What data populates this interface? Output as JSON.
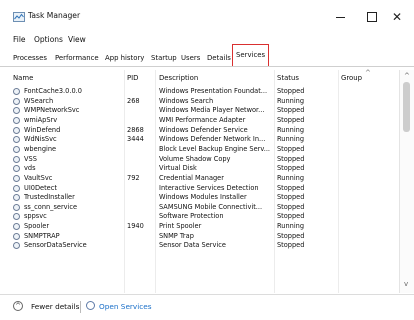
{
  "window": {
    "title": "Task Manager",
    "minimize_icon": "minimize-icon",
    "maximize_icon": "maximize-icon",
    "close_icon": "close-icon",
    "close_glyph": "✕"
  },
  "menu": [
    "File",
    "Options",
    "View"
  ],
  "tabs": [
    {
      "label": "Processes",
      "active": false
    },
    {
      "label": "Performance",
      "active": false
    },
    {
      "label": "App history",
      "active": false
    },
    {
      "label": "Startup",
      "active": false
    },
    {
      "label": "Users",
      "active": false
    },
    {
      "label": "Details",
      "active": false
    },
    {
      "label": "Services",
      "active": true
    }
  ],
  "columns": [
    "Name",
    "PID",
    "Description",
    "Status",
    "Group"
  ],
  "rows": [
    {
      "name": "FontCache3.0.0.0",
      "pid": "",
      "description": "Windows Presentation Foundat...",
      "status": "Stopped",
      "group": ""
    },
    {
      "name": "WSearch",
      "pid": "268",
      "description": "Windows Search",
      "status": "Running",
      "group": ""
    },
    {
      "name": "WMPNetworkSvc",
      "pid": "",
      "description": "Windows Media Player Networ...",
      "status": "Stopped",
      "group": ""
    },
    {
      "name": "wmiApSrv",
      "pid": "",
      "description": "WMI Performance Adapter",
      "status": "Stopped",
      "group": ""
    },
    {
      "name": "WinDefend",
      "pid": "2868",
      "description": "Windows Defender Service",
      "status": "Running",
      "group": ""
    },
    {
      "name": "WdNisSvc",
      "pid": "3444",
      "description": "Windows Defender Network In...",
      "status": "Running",
      "group": ""
    },
    {
      "name": "wbengine",
      "pid": "",
      "description": "Block Level Backup Engine Serv...",
      "status": "Stopped",
      "group": ""
    },
    {
      "name": "VSS",
      "pid": "",
      "description": "Volume Shadow Copy",
      "status": "Stopped",
      "group": ""
    },
    {
      "name": "vds",
      "pid": "",
      "description": "Virtual Disk",
      "status": "Stopped",
      "group": ""
    },
    {
      "name": "VaultSvc",
      "pid": "792",
      "description": "Credential Manager",
      "status": "Running",
      "group": ""
    },
    {
      "name": "UI0Detect",
      "pid": "",
      "description": "Interactive Services Detection",
      "status": "Stopped",
      "group": ""
    },
    {
      "name": "TrustedInstaller",
      "pid": "",
      "description": "Windows Modules Installer",
      "status": "Stopped",
      "group": ""
    },
    {
      "name": "ss_conn_service",
      "pid": "",
      "description": "SAMSUNG Mobile Connectivit...",
      "status": "Stopped",
      "group": ""
    },
    {
      "name": "sppsvc",
      "pid": "",
      "description": "Software Protection",
      "status": "Stopped",
      "group": ""
    },
    {
      "name": "Spooler",
      "pid": "1940",
      "description": "Print Spooler",
      "status": "Running",
      "group": ""
    },
    {
      "name": "SNMPTRAP",
      "pid": "",
      "description": "SNMP Trap",
      "status": "Stopped",
      "group": ""
    },
    {
      "name": "SensorDataService",
      "pid": "",
      "description": "Sensor Data Service",
      "status": "Stopped",
      "group": ""
    }
  ],
  "footer": {
    "fewer_details": "Fewer details",
    "open_services": "Open Services"
  }
}
